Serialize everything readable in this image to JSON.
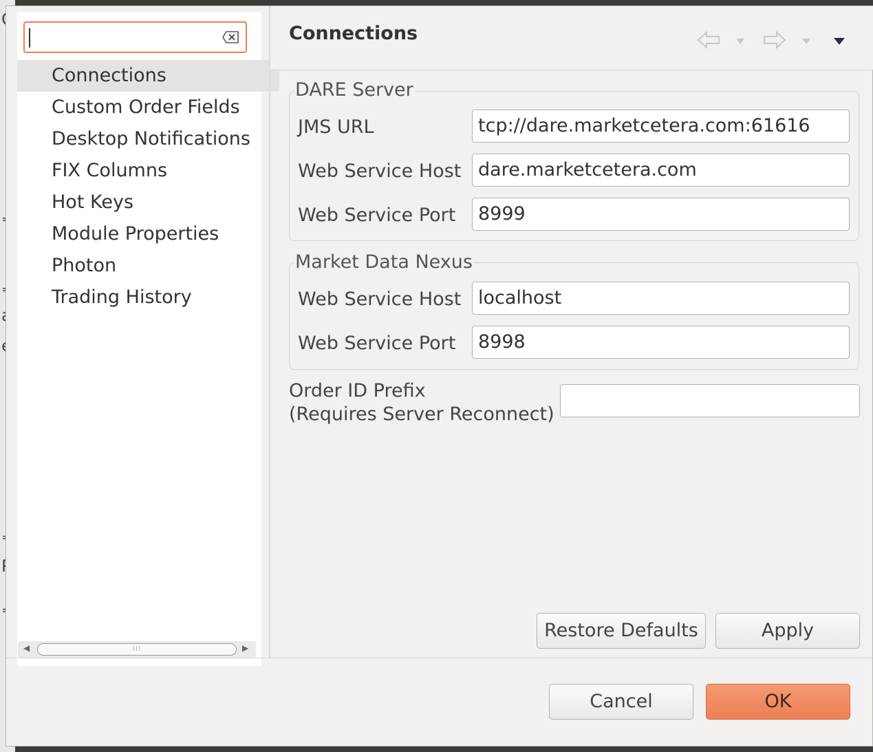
{
  "background": {
    "fragments": [
      "Q",
      "=",
      "=",
      "ac",
      "e",
      "=",
      "P",
      "="
    ]
  },
  "filter": {
    "value": ""
  },
  "tree": {
    "items": [
      {
        "label": "Connections",
        "selected": true
      },
      {
        "label": "Custom Order Fields"
      },
      {
        "label": "Desktop Notifications"
      },
      {
        "label": "FIX Columns"
      },
      {
        "label": "Hot Keys"
      },
      {
        "label": "Module Properties"
      },
      {
        "label": "Photon"
      },
      {
        "label": "Trading History"
      }
    ]
  },
  "page": {
    "title": "Connections"
  },
  "dare_server": {
    "legend": "DARE Server",
    "jms_url_label": "JMS URL",
    "jms_url_value": "tcp://dare.marketcetera.com:61616",
    "host_label": "Web Service Host",
    "host_value": "dare.marketcetera.com",
    "port_label": "Web Service Port",
    "port_value": "8999"
  },
  "market_data": {
    "legend": "Market Data Nexus",
    "host_label": "Web Service Host",
    "host_value": "localhost",
    "port_label": "Web Service Port",
    "port_value": "8998"
  },
  "order_id": {
    "label_line1": "Order ID Prefix",
    "label_line2": "(Requires Server Reconnect)",
    "value": ""
  },
  "buttons": {
    "restore_defaults": "Restore Defaults",
    "apply": "Apply",
    "cancel": "Cancel",
    "ok": "OK"
  },
  "colors": {
    "accent": "#ee7f55",
    "focus_border": "#e9804a"
  }
}
